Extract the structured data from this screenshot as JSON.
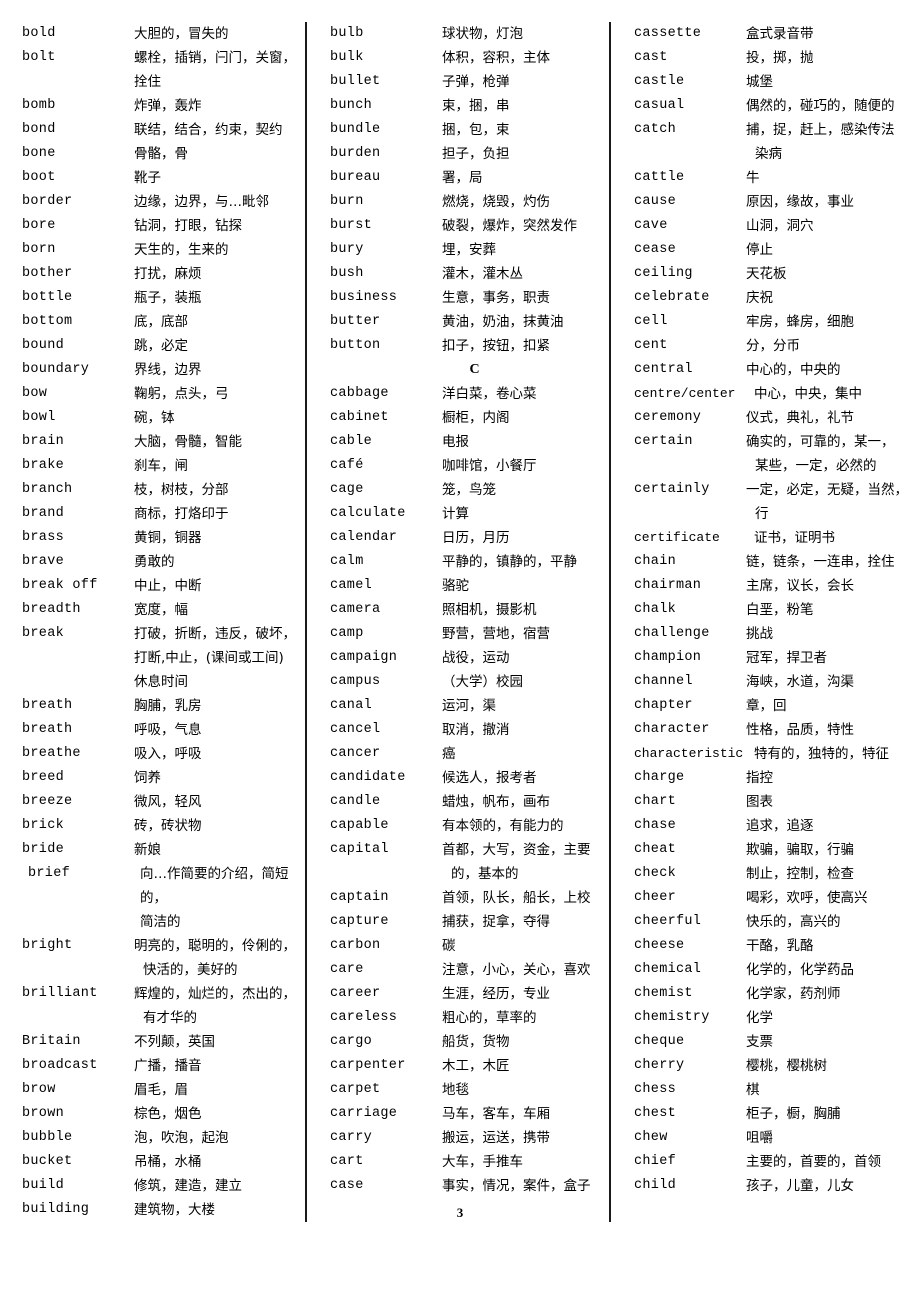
{
  "document": {
    "page_number": "3",
    "section_headings": {
      "c": "C"
    }
  },
  "columns": [
    {
      "id": "column-1",
      "entries": [
        {
          "term": "bold",
          "definition": "大胆的，冒失的"
        },
        {
          "term": "bolt",
          "definition": "螺栓，插销，闩门，关窗，\n拴住"
        },
        {
          "term": "bomb",
          "definition": "炸弹，轰炸"
        },
        {
          "term": "bond",
          "definition": "联结，结合，约束，契约"
        },
        {
          "term": "bone",
          "definition": "骨骼，骨"
        },
        {
          "term": "boot",
          "definition": "靴子"
        },
        {
          "term": "border",
          "definition": "边缘，边界，与…毗邻"
        },
        {
          "term": "bore",
          "definition": "钻洞，打眼，钻探"
        },
        {
          "term": "born",
          "definition": "天生的，生来的"
        },
        {
          "term": "bother",
          "definition": "打扰，麻烦"
        },
        {
          "term": "bottle",
          "definition": "瓶子，装瓶"
        },
        {
          "term": "bottom",
          "definition": "底，底部"
        },
        {
          "term": "bound",
          "definition": "跳，必定"
        },
        {
          "term": "boundary",
          "definition": "界线，边界"
        },
        {
          "term": "bow",
          "definition": "鞠躬，点头，弓"
        },
        {
          "term": "bowl",
          "definition": "碗，钵"
        },
        {
          "term": "brain",
          "definition": "大脑，骨髓，智能"
        },
        {
          "term": "brake",
          "definition": "刹车，闸"
        },
        {
          "term": "branch",
          "definition": "枝，树枝，分部"
        },
        {
          "term": "brand",
          "definition": "商标，打烙印于"
        },
        {
          "term": "brass",
          "definition": "黄铜，铜器"
        },
        {
          "term": "brave",
          "definition": "勇敢的"
        },
        {
          "term": "break off",
          "definition": "中止，中断"
        },
        {
          "term": "breadth",
          "definition": "宽度，幅"
        },
        {
          "term": "break",
          "definition": "打破，折断，违反，破坏，\n打断,中止，(课间或工间)\n休息时间"
        },
        {
          "term": "breath",
          "definition": "胸脯，乳房"
        },
        {
          "term": "breath",
          "definition": "呼吸，气息"
        },
        {
          "term": "breathe",
          "definition": "吸入，呼吸"
        },
        {
          "term": "breed",
          "definition": "饲养"
        },
        {
          "term": "breeze",
          "definition": "微风，轻风"
        },
        {
          "term": "brick",
          "definition": "砖，砖状物"
        },
        {
          "term": "bride",
          "definition": "新娘"
        },
        {
          "term": "brief",
          "definition": "向…作简要的介绍，简短的，\n简洁的",
          "indent": true
        },
        {
          "term": "bright",
          "definition": "明亮的，聪明的，伶俐的，\n快活的，美好的",
          "wrap_indent": true
        },
        {
          "term": "brilliant",
          "definition": "辉煌的，灿烂的，杰出的，\n有才华的",
          "wrap_indent": true
        },
        {
          "term": "Britain",
          "definition": "不列颠，英国"
        },
        {
          "term": "broadcast",
          "definition": "广播，播音"
        },
        {
          "term": "brow",
          "definition": "眉毛，眉"
        },
        {
          "term": "brown",
          "definition": "棕色，烟色"
        },
        {
          "term": "bubble",
          "definition": "泡，吹泡，起泡"
        },
        {
          "term": "bucket",
          "definition": "吊桶，水桶"
        },
        {
          "term": "build",
          "definition": "修筑，建造，建立"
        },
        {
          "term": "building",
          "definition": "建筑物，大楼"
        }
      ]
    },
    {
      "id": "column-2",
      "entries": [
        {
          "term": "bulb",
          "definition": "球状物，灯泡"
        },
        {
          "term": "bulk",
          "definition": "体积，容积，主体"
        },
        {
          "term": "bullet",
          "definition": "子弹，枪弹"
        },
        {
          "term": "bunch",
          "definition": "束，捆，串"
        },
        {
          "term": "bundle",
          "definition": "捆，包，束"
        },
        {
          "term": "burden",
          "definition": "担子，负担"
        },
        {
          "term": "bureau",
          "definition": "署，局"
        },
        {
          "term": "burn",
          "definition": "燃烧，烧毁，灼伤"
        },
        {
          "term": "burst",
          "definition": "破裂，爆炸，突然发作"
        },
        {
          "term": "bury",
          "definition": "埋，安葬"
        },
        {
          "term": "bush",
          "definition": "灌木，灌木丛"
        },
        {
          "term": "business",
          "definition": "生意，事务，职责"
        },
        {
          "term": "butter",
          "definition": "黄油，奶油，抹黄油"
        },
        {
          "term": "button",
          "definition": "扣子，按钮，扣紧"
        },
        {
          "section": "C"
        },
        {
          "term": "cabbage",
          "definition": "洋白菜，卷心菜"
        },
        {
          "term": "cabinet",
          "definition": "橱柜，内阁"
        },
        {
          "term": "cable",
          "definition": "电报"
        },
        {
          "term": "café",
          "definition": "咖啡馆，小餐厅"
        },
        {
          "term": "cage",
          "definition": "笼，鸟笼"
        },
        {
          "term": "calculate",
          "definition": "计算"
        },
        {
          "term": "calendar",
          "definition": "日历，月历"
        },
        {
          "term": "calm",
          "definition": "平静的，镇静的，平静"
        },
        {
          "term": "camel",
          "definition": "骆驼"
        },
        {
          "term": "camera",
          "definition": "照相机，摄影机"
        },
        {
          "term": "camp",
          "definition": "野营，营地，宿营"
        },
        {
          "term": "campaign",
          "definition": "战役，运动"
        },
        {
          "term": "campus",
          "definition": "（大学）校园"
        },
        {
          "term": "canal",
          "definition": "运河，渠"
        },
        {
          "term": "cancel",
          "definition": "取消，撤消"
        },
        {
          "term": "cancer",
          "definition": "癌"
        },
        {
          "term": "candidate",
          "definition": "候选人，报考者"
        },
        {
          "term": "candle",
          "definition": "蜡烛，帆布，画布"
        },
        {
          "term": "capable",
          "definition": "有本领的，有能力的"
        },
        {
          "term": "capital",
          "definition": "首都，大写，资金，主要\n的，基本的",
          "wrap_indent": true
        },
        {
          "term": "captain",
          "definition": "首领，队长，船长，上校"
        },
        {
          "term": "capture",
          "definition": "捕获，捉拿，夺得"
        },
        {
          "term": "carbon",
          "definition": "碳"
        },
        {
          "term": "care",
          "definition": "注意，小心，关心，喜欢"
        },
        {
          "term": "career",
          "definition": "生涯，经历，专业"
        },
        {
          "term": "careless",
          "definition": "粗心的，草率的"
        },
        {
          "term": "cargo",
          "definition": "船货，货物"
        },
        {
          "term": "carpenter",
          "definition": "木工，木匠"
        },
        {
          "term": "carpet",
          "definition": "地毯"
        },
        {
          "term": "carriage",
          "definition": "马车，客车，车厢"
        },
        {
          "term": "carry",
          "definition": "搬运，运送，携带"
        },
        {
          "term": "cart",
          "definition": "大车，手推车"
        },
        {
          "term": "case",
          "definition": "事实，情况，案件，盒子"
        }
      ]
    },
    {
      "id": "column-3",
      "entries": [
        {
          "term": "cassette",
          "definition": "盒式录音带"
        },
        {
          "term": "cast",
          "definition": "投，掷，抛"
        },
        {
          "term": "castle",
          "definition": "城堡"
        },
        {
          "term": "casual",
          "definition": "偶然的，碰巧的，随便的"
        },
        {
          "term": "catch",
          "definition": "捕，捉，赶上，感染传法\n染病",
          "wrap_indent": true
        },
        {
          "term": "cattle",
          "definition": "牛"
        },
        {
          "term": "cause",
          "definition": "原因，缘故，事业"
        },
        {
          "term": "cave",
          "definition": "山洞，洞穴"
        },
        {
          "term": "cease",
          "definition": "停止"
        },
        {
          "term": "ceiling",
          "definition": "天花板"
        },
        {
          "term": "celebrate",
          "definition": "庆祝"
        },
        {
          "term": "cell",
          "definition": "牢房，蜂房，细胞"
        },
        {
          "term": "cent",
          "definition": "分，分币"
        },
        {
          "term": "central",
          "definition": "中心的，中央的"
        },
        {
          "term": "centre/center",
          "definition": "中心，中央，集中",
          "wide": true
        },
        {
          "term": "ceremony",
          "definition": "仪式，典礼，礼节"
        },
        {
          "term": "certain",
          "definition": "确实的，可靠的，某一，\n某些，一定，必然的",
          "wrap_indent": true
        },
        {
          "term": "certainly",
          "definition": "一定，必定，无疑，当然，\n行",
          "wrap_indent": true
        },
        {
          "term": "certificate",
          "definition": "证书，证明书",
          "wide": true
        },
        {
          "term": "chain",
          "definition": "链，链条，一连串，拴住"
        },
        {
          "term": "chairman",
          "definition": "主席，议长，会长"
        },
        {
          "term": "chalk",
          "definition": "白垩，粉笔"
        },
        {
          "term": "challenge",
          "definition": "挑战"
        },
        {
          "term": "champion",
          "definition": "冠军，捍卫者"
        },
        {
          "term": "channel",
          "definition": "海峡，水道，沟渠"
        },
        {
          "term": "chapter",
          "definition": "章，回"
        },
        {
          "term": "character",
          "definition": "性格，品质，特性"
        },
        {
          "term": "characteristic",
          "definition": "特有的，独特的，特征",
          "wide": true
        },
        {
          "term": "charge",
          "definition": "指控"
        },
        {
          "term": "chart",
          "definition": "图表"
        },
        {
          "term": "chase",
          "definition": "追求，追逐"
        },
        {
          "term": "cheat",
          "definition": "欺骗，骗取，行骗"
        },
        {
          "term": "check",
          "definition": "制止，控制，检查"
        },
        {
          "term": "cheer",
          "definition": "喝彩，欢呼，使高兴"
        },
        {
          "term": "cheerful",
          "definition": "快乐的，高兴的"
        },
        {
          "term": "cheese",
          "definition": "干酪，乳酪"
        },
        {
          "term": "chemical",
          "definition": "化学的，化学药品"
        },
        {
          "term": "chemist",
          "definition": "化学家，药剂师"
        },
        {
          "term": "chemistry",
          "definition": "化学"
        },
        {
          "term": "cheque",
          "definition": "支票"
        },
        {
          "term": "cherry",
          "definition": "樱桃，樱桃树"
        },
        {
          "term": "chess",
          "definition": "棋"
        },
        {
          "term": "chest",
          "definition": "柜子，橱，胸脯"
        },
        {
          "term": "chew",
          "definition": "咀嚼"
        },
        {
          "term": "chief",
          "definition": "主要的，首要的，首领"
        },
        {
          "term": "child",
          "definition": "孩子，儿童，儿女"
        }
      ]
    }
  ]
}
